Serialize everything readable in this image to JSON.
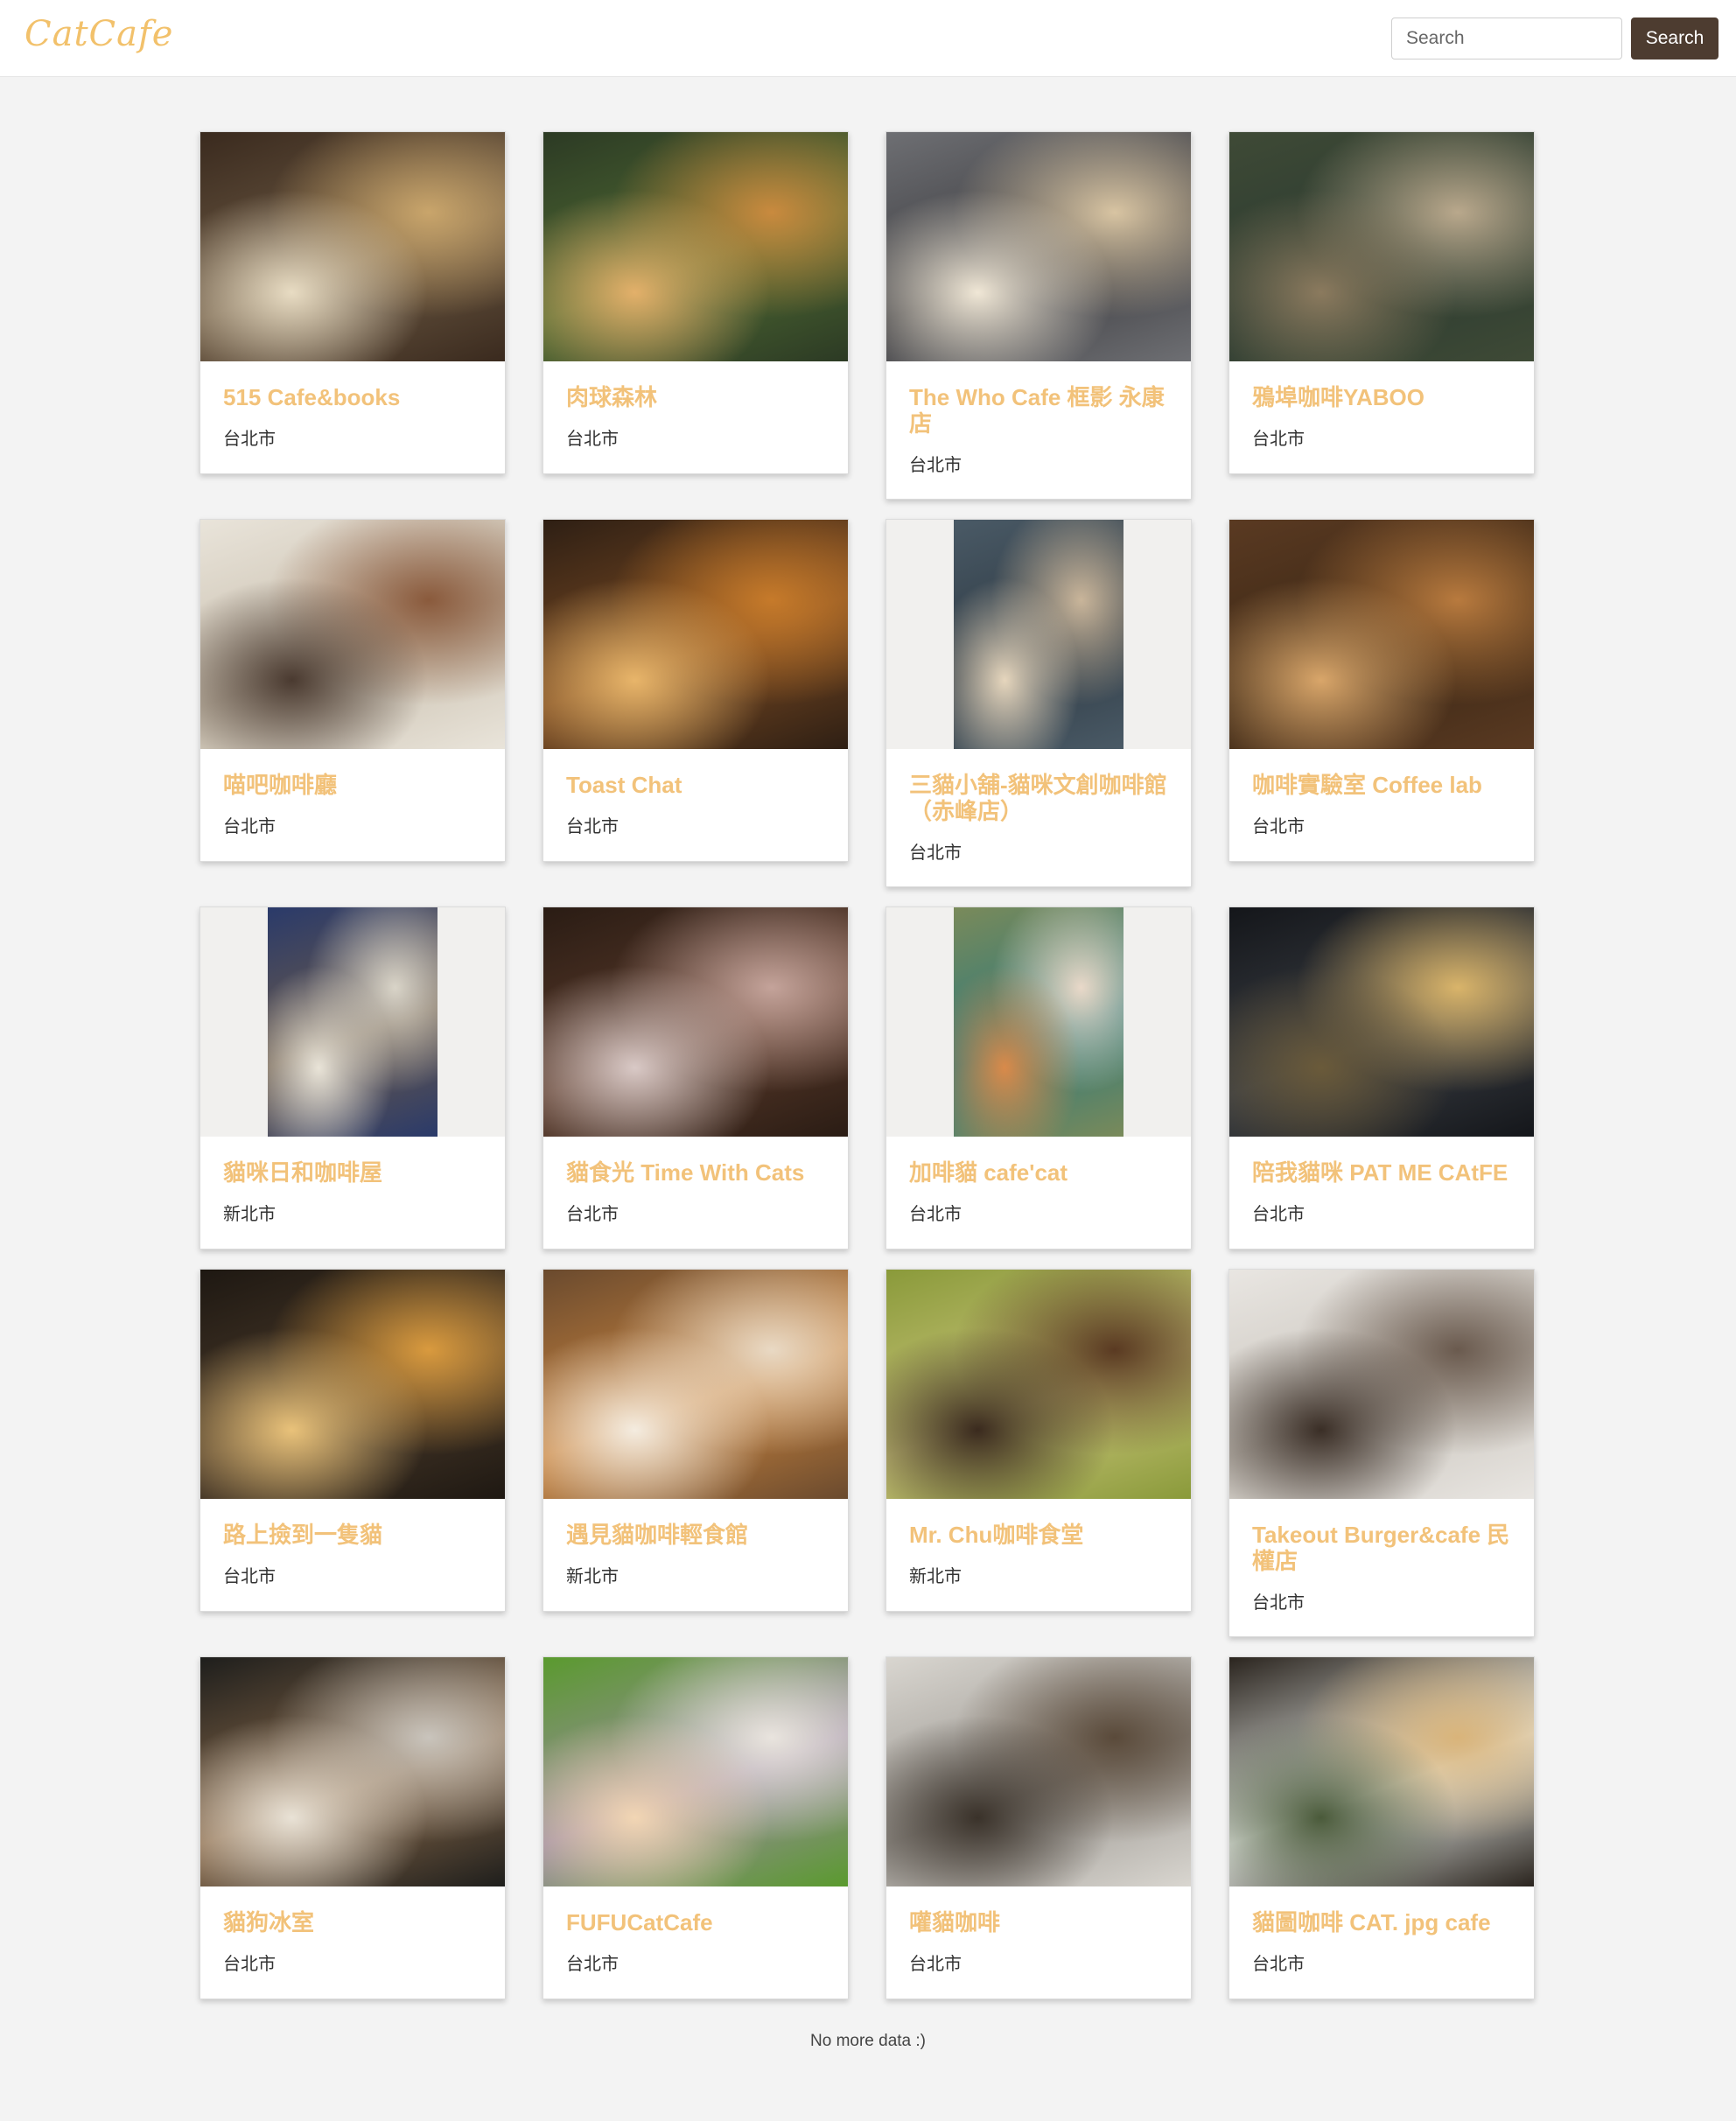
{
  "brand": {
    "logo": "CatCafe"
  },
  "search": {
    "placeholder": "Search",
    "button_label": "Search"
  },
  "cafes": [
    {
      "name": "515 Cafe&books",
      "city": "台北市",
      "photo": {
        "colors": [
          "#3a2a1e",
          "#c9a56b",
          "#6d5a44",
          "#e8dcc3"
        ],
        "full": true
      }
    },
    {
      "name": "肉球森林",
      "city": "台北市",
      "photo": {
        "colors": [
          "#2c3a24",
          "#c98a3e",
          "#4f6b33",
          "#e3b06a"
        ],
        "full": true
      }
    },
    {
      "name": "The Who Cafe 框影 永康店",
      "city": "台北市",
      "photo": {
        "colors": [
          "#6e6f73",
          "#d8c4a2",
          "#3b3b3f",
          "#f0e7d6"
        ],
        "full": true
      }
    },
    {
      "name": "鴉埠咖啡YABOO",
      "city": "台北市",
      "photo": {
        "colors": [
          "#3f4a36",
          "#b9a88c",
          "#2a3a30",
          "#8b7a5e"
        ],
        "full": true
      }
    },
    {
      "name": "喵吧咖啡廳",
      "city": "台北市",
      "photo": {
        "colors": [
          "#e9e4da",
          "#8a5a3c",
          "#c9bfae",
          "#4a3a30"
        ],
        "full": true
      }
    },
    {
      "name": "Toast Chat",
      "city": "台北市",
      "photo": {
        "colors": [
          "#2e1f14",
          "#c67a2a",
          "#7a4a22",
          "#e8b56a"
        ],
        "full": true
      }
    },
    {
      "name": "三貓小舖-貓咪文創咖啡館（赤峰店）",
      "city": "台北市",
      "photo": {
        "colors": [
          "#4a5a66",
          "#c9b59a",
          "#2e3a44",
          "#e6d6bd"
        ],
        "full": false
      }
    },
    {
      "name": "咖啡實驗室 Coffee lab",
      "city": "台北市",
      "photo": {
        "colors": [
          "#5a3a22",
          "#b87a3e",
          "#3a2614",
          "#d9a66a"
        ],
        "full": true
      }
    },
    {
      "name": "貓咪日和咖啡屋",
      "city": "新北市",
      "photo": {
        "colors": [
          "#2a3a6a",
          "#d9d4c8",
          "#6a5a4a",
          "#e9e4d8"
        ],
        "full": false
      }
    },
    {
      "name": "貓食光 Time With Cats",
      "city": "台北市",
      "photo": {
        "colors": [
          "#2a1c14",
          "#c4a39a",
          "#5a3a2a",
          "#d9c9c6"
        ],
        "full": true
      }
    },
    {
      "name": "加啡貓 cafe'cat",
      "city": "台北市",
      "photo": {
        "colors": [
          "#7a8a5a",
          "#e9d9c9",
          "#2f7a7a",
          "#d98a4a"
        ],
        "full": false
      }
    },
    {
      "name": "陪我貓咪 PAT ME CAtFE",
      "city": "台北市",
      "photo": {
        "colors": [
          "#14161a",
          "#d9b46a",
          "#3a3e44",
          "#6a5a3a"
        ],
        "full": true
      }
    },
    {
      "name": "路上撿到一隻貓",
      "city": "台北市",
      "photo": {
        "colors": [
          "#1e1812",
          "#d99a3e",
          "#4a3a2a",
          "#e9c27a"
        ],
        "full": true
      }
    },
    {
      "name": "遇見貓咖啡輕食館",
      "city": "新北市",
      "photo": {
        "colors": [
          "#6a4a2e",
          "#e9d9c4",
          "#c9843e",
          "#f4ece0"
        ],
        "full": true
      }
    },
    {
      "name": "Mr. Chu咖啡食堂",
      "city": "新北市",
      "photo": {
        "colors": [
          "#8a9a3a",
          "#5a3a22",
          "#c9c47a",
          "#3a2a1e"
        ],
        "full": true
      }
    },
    {
      "name": "Takeout Burger&cafe 民權店",
      "city": "台北市",
      "photo": {
        "colors": [
          "#e9e6e2",
          "#6a5a4e",
          "#c9c4bc",
          "#3a2e26"
        ],
        "full": true
      }
    },
    {
      "name": "貓狗冰室",
      "city": "台北市",
      "photo": {
        "colors": [
          "#1e1e1c",
          "#c9c4bc",
          "#8a6a4a",
          "#e9e2d6"
        ],
        "full": true
      }
    },
    {
      "name": "FUFUCatCafe",
      "city": "台北市",
      "photo": {
        "colors": [
          "#5a9a2e",
          "#e9e4de",
          "#9a8aa2",
          "#f2d6b4"
        ],
        "full": true
      }
    },
    {
      "name": "嚾貓咖啡",
      "city": "台北市",
      "photo": {
        "colors": [
          "#d9d6d0",
          "#5a4a3a",
          "#9a9690",
          "#3a322a"
        ],
        "full": true
      }
    },
    {
      "name": "貓圖咖啡 CAT. jpg cafe",
      "city": "台北市",
      "photo": {
        "colors": [
          "#2a241e",
          "#d9b47a",
          "#e9ece8",
          "#4a5a3a"
        ],
        "full": true
      }
    }
  ],
  "footer": {
    "note": "No more data :)"
  }
}
